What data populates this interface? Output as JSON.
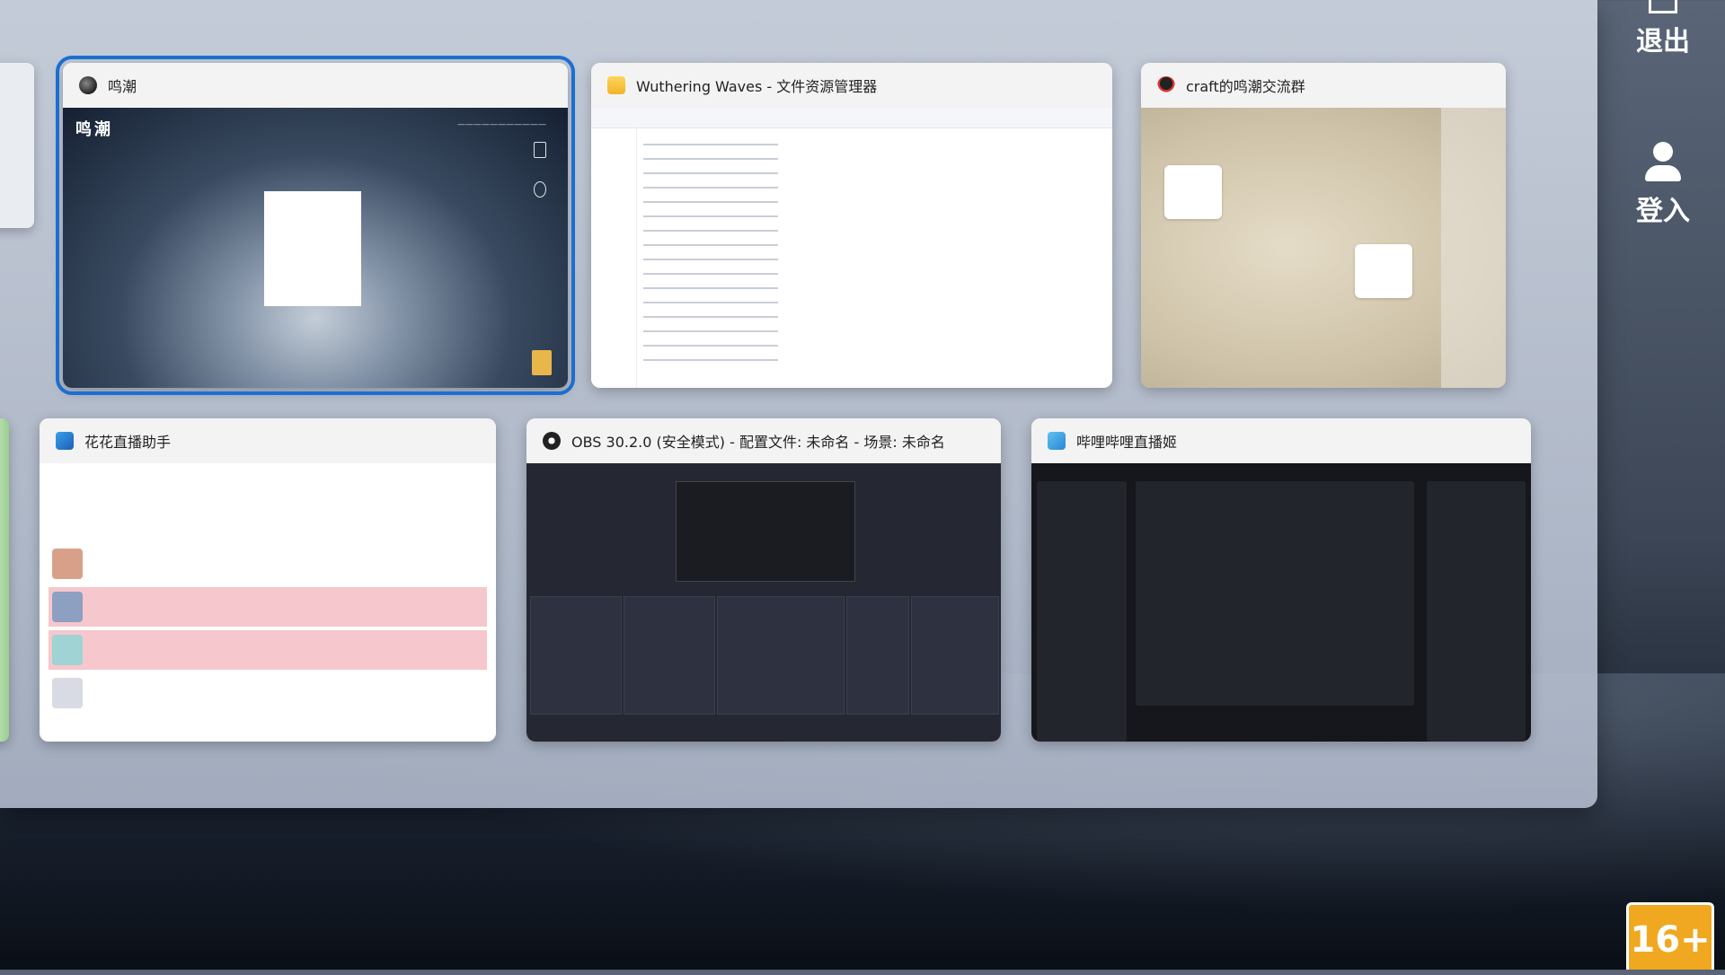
{
  "windows": {
    "wuthering": {
      "title": "鸣潮",
      "logo": "鸣潮"
    },
    "explorer": {
      "title": "Wuthering Waves - 文件资源管理器"
    },
    "qqgroup": {
      "title": "craft的鸣潮交流群"
    },
    "huahua": {
      "title": "花花直播助手"
    },
    "obs": {
      "title": "OBS 30.2.0 (安全模式) - 配置文件: 未命名 - 场景: 未命名"
    },
    "bililive": {
      "title": "哔哩哔哩直播姬"
    }
  },
  "side_actions": {
    "exit_label": "退出",
    "login_label": "登入"
  },
  "age_rating": "16+",
  "colors": {
    "selected_outline": "#1a6fd1",
    "huahua_highlight": "#f6c7cc",
    "age_badge": "#f0a821"
  },
  "icons": {
    "wuthering": "wuthering-waves-icon",
    "explorer": "folder-icon",
    "qqgroup": "qq-penguin-icon",
    "huahua": "huahua-icon",
    "obs": "obs-icon",
    "bililive": "bilibili-live-icon",
    "exit": "exit-icon",
    "login": "user-icon"
  }
}
